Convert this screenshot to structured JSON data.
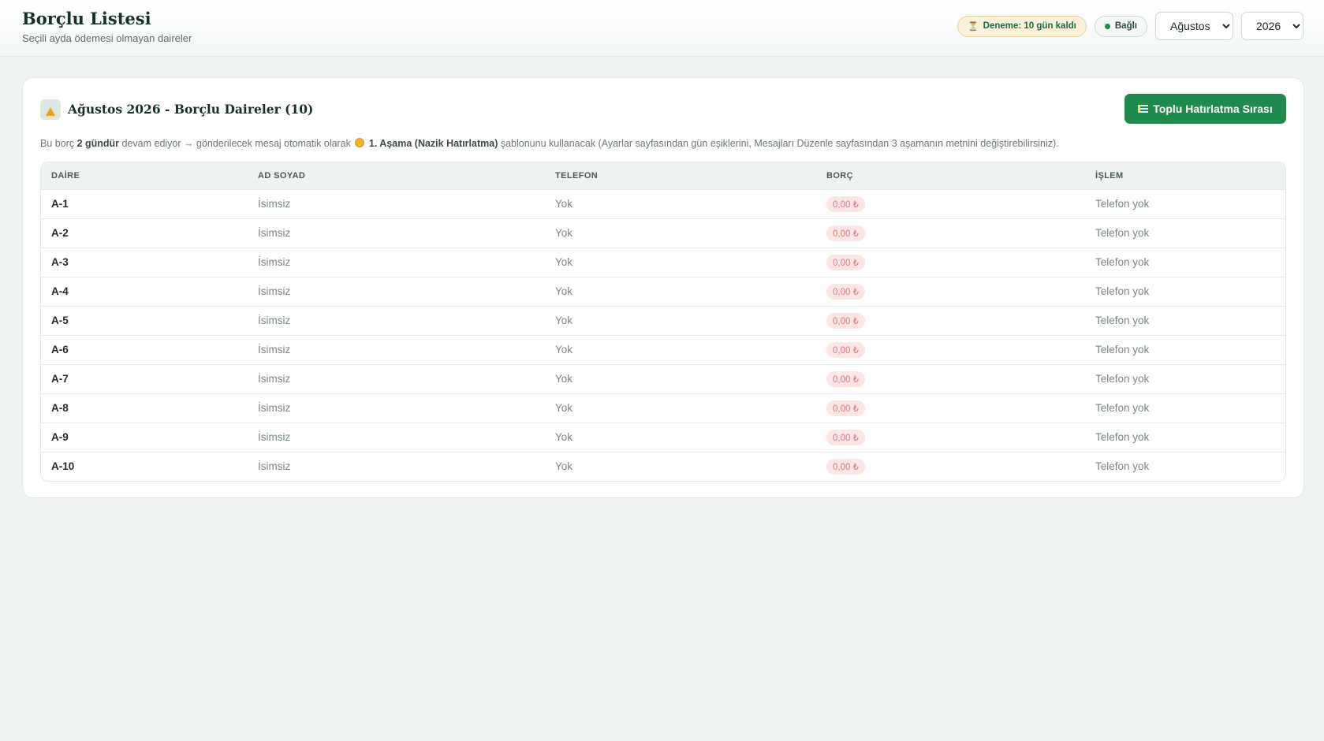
{
  "header": {
    "title": "Borçlu Listesi",
    "subtitle": "Seçili ayda ödemesi olmayan daireler",
    "trial_badge": "Deneme: 10 gün kaldı",
    "status_badge": "Bağlı",
    "month_selected": "Ağustos",
    "year_selected": "2026",
    "status_color": "#1f8a4c"
  },
  "card": {
    "title": "Ağustos 2026 - Borçlu Daireler (10)",
    "bulk_button": "Toplu Hatırlatma Sırası",
    "info": {
      "part1": "Bu borç ",
      "days": "2 gündür",
      "part2": " devam ediyor → gönderilecek mesaj otomatik olarak ",
      "stage": "1. Aşama (Nazik Hatırlatma)",
      "part3": " şablonunu kullanacak (Ayarlar sayfasından gün eşiklerini, Mesajları Düzenle sayfasından 3 aşamanın metnini değiştirebilirsiniz)."
    }
  },
  "table": {
    "headers": [
      "DAİRE",
      "AD SOYAD",
      "TELEFON",
      "BORÇ",
      "İŞLEM"
    ],
    "rows": [
      {
        "daire": "A-1",
        "name": "İsimsiz",
        "phone": "Yok",
        "debt": "0,00 ₺",
        "action": "Telefon yok"
      },
      {
        "daire": "A-2",
        "name": "İsimsiz",
        "phone": "Yok",
        "debt": "0,00 ₺",
        "action": "Telefon yok"
      },
      {
        "daire": "A-3",
        "name": "İsimsiz",
        "phone": "Yok",
        "debt": "0,00 ₺",
        "action": "Telefon yok"
      },
      {
        "daire": "A-4",
        "name": "İsimsiz",
        "phone": "Yok",
        "debt": "0,00 ₺",
        "action": "Telefon yok"
      },
      {
        "daire": "A-5",
        "name": "İsimsiz",
        "phone": "Yok",
        "debt": "0,00 ₺",
        "action": "Telefon yok"
      },
      {
        "daire": "A-6",
        "name": "İsimsiz",
        "phone": "Yok",
        "debt": "0,00 ₺",
        "action": "Telefon yok"
      },
      {
        "daire": "A-7",
        "name": "İsimsiz",
        "phone": "Yok",
        "debt": "0,00 ₺",
        "action": "Telefon yok"
      },
      {
        "daire": "A-8",
        "name": "İsimsiz",
        "phone": "Yok",
        "debt": "0,00 ₺",
        "action": "Telefon yok"
      },
      {
        "daire": "A-9",
        "name": "İsimsiz",
        "phone": "Yok",
        "debt": "0,00 ₺",
        "action": "Telefon yok"
      },
      {
        "daire": "A-10",
        "name": "İsimsiz",
        "phone": "Yok",
        "debt": "0,00 ₺",
        "action": "Telefon yok"
      }
    ]
  },
  "icons": {
    "trial": "hourglass-icon",
    "status": "status-dot-icon",
    "card": "warning-icon",
    "bulk": "list-icon",
    "stage": "coin-icon"
  }
}
